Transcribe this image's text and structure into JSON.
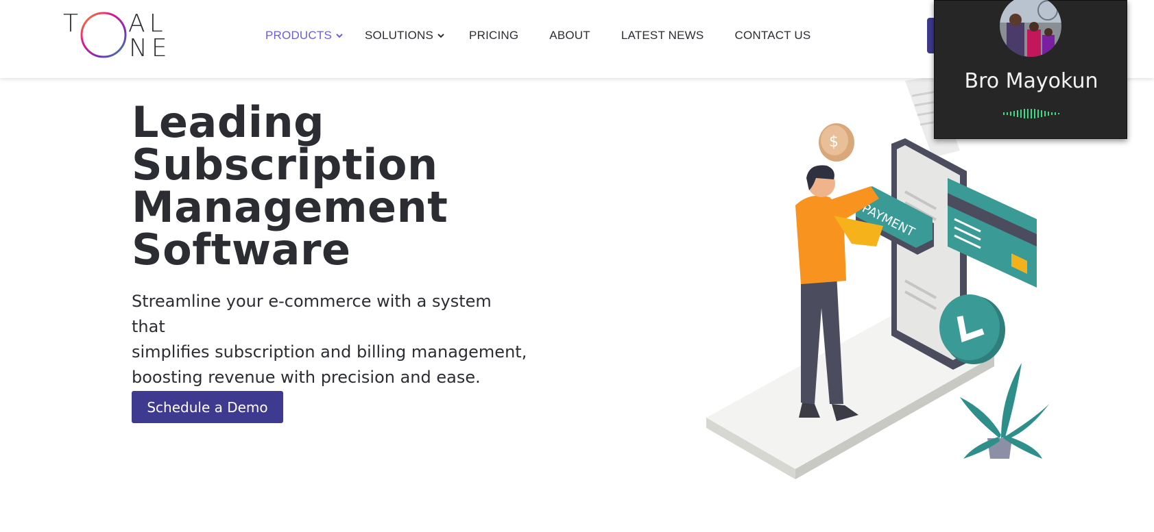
{
  "logo": {
    "letter_t": "T",
    "letters_al": "AL",
    "letters_ne": "NE",
    "ring_colors": [
      "#f7931e",
      "#e0188b",
      "#7a2bbf",
      "#2a9d8f"
    ]
  },
  "nav": {
    "items": [
      {
        "label": "PRODUCTS",
        "dropdown": true,
        "active": true
      },
      {
        "label": "SOLUTIONS",
        "dropdown": true,
        "active": false
      },
      {
        "label": "PRICING",
        "dropdown": false,
        "active": false
      },
      {
        "label": "ABOUT",
        "dropdown": false,
        "active": false
      },
      {
        "label": "LATEST NEWS",
        "dropdown": false,
        "active": false
      },
      {
        "label": "CONTACT US",
        "dropdown": false,
        "active": false
      }
    ],
    "active_color": "#6a5ed6"
  },
  "call": {
    "participant_name": "Bro Mayokun",
    "wave_color": "#3ddc84"
  },
  "hero": {
    "title_lines": [
      "Leading",
      "Subscription",
      "Management",
      "Software"
    ],
    "subtitle_lines": [
      "Streamline your e-commerce with a system that",
      "simplifies subscription and billing management,",
      "boosting revenue with precision and ease."
    ],
    "cta_label": "Schedule a Demo"
  },
  "illustration": {
    "payment_label": "PAYMENT",
    "coin_symbol": "$"
  },
  "colors": {
    "brand_primary": "#3d3a8f",
    "text": "#2b2d33",
    "teal": "#3a9a95",
    "orange": "#f7931e"
  }
}
